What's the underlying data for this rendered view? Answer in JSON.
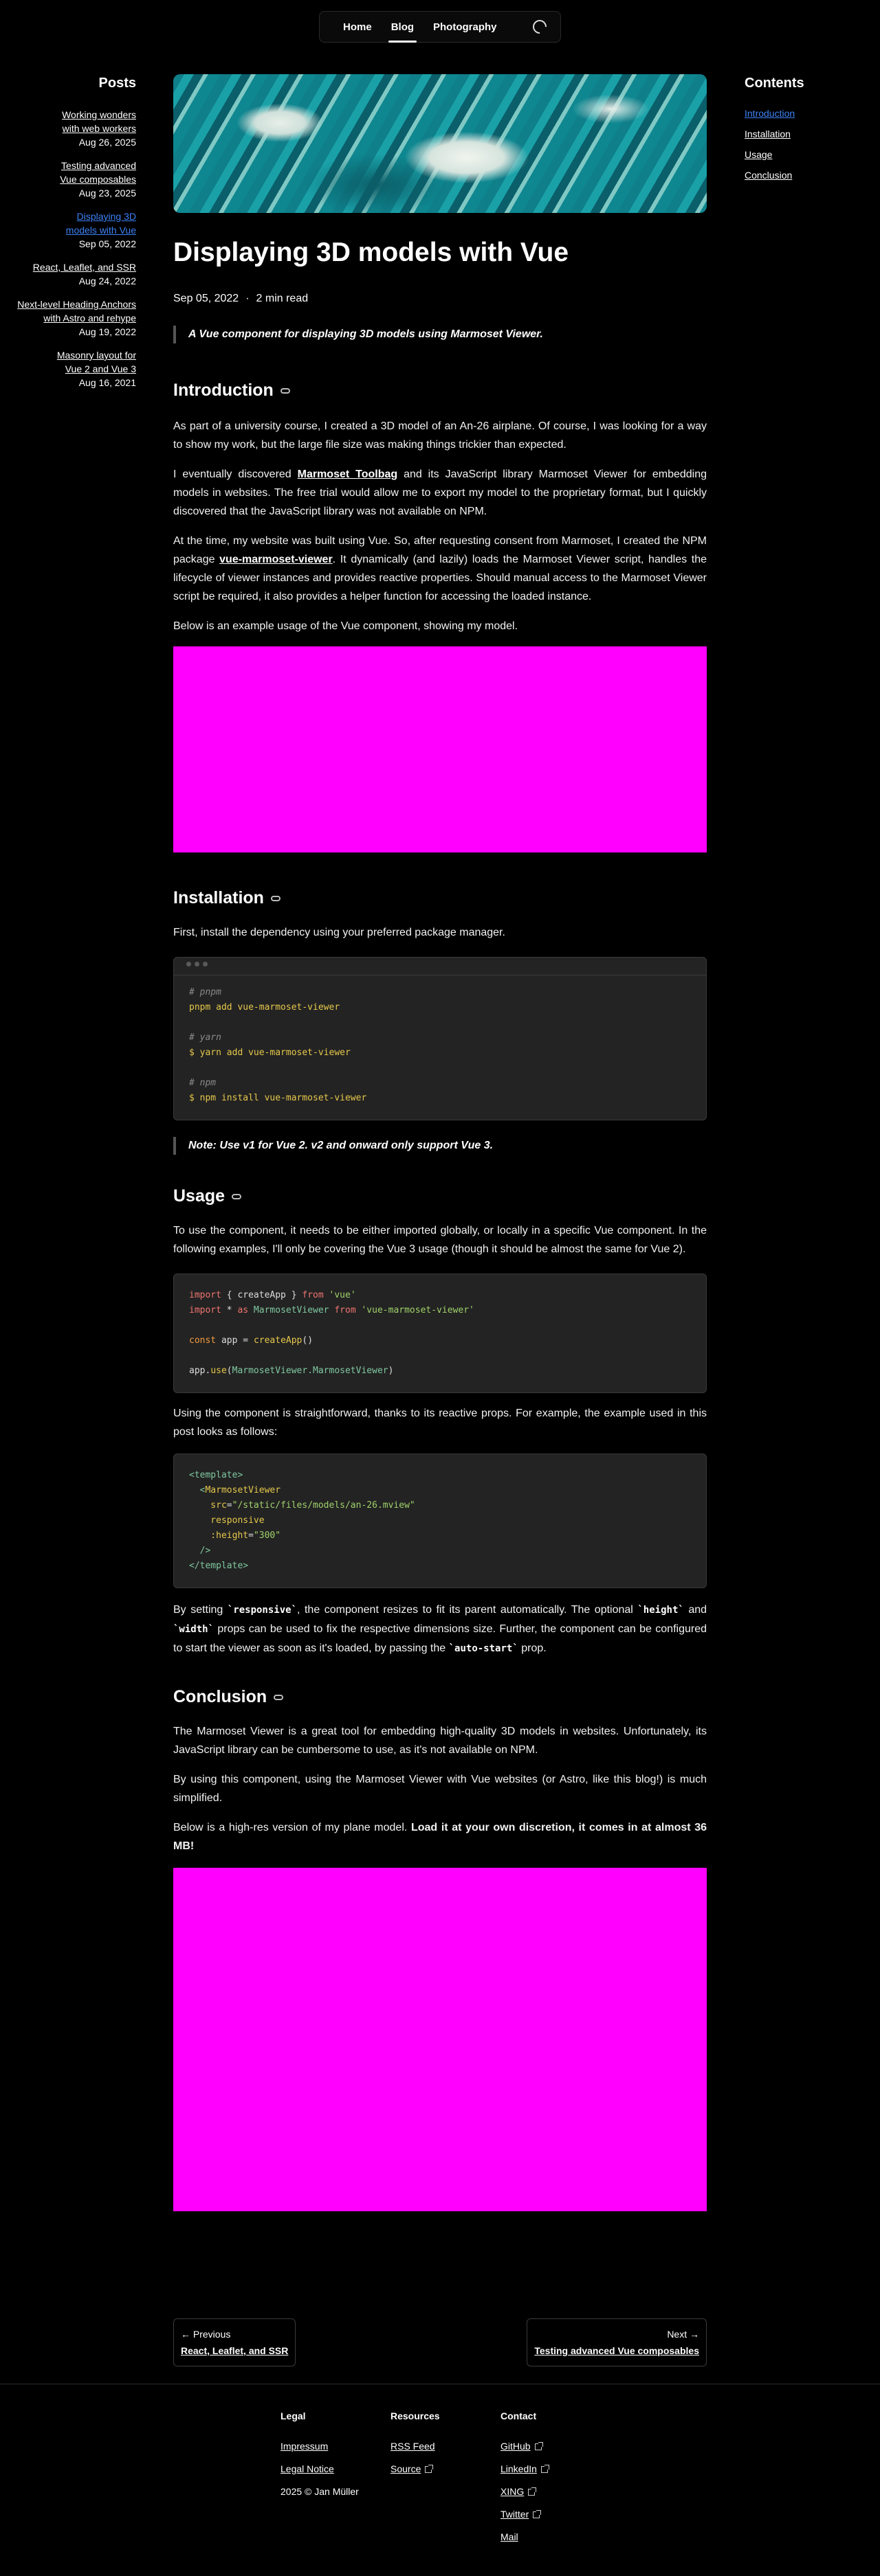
{
  "nav": {
    "items": [
      "Home",
      "Blog",
      "Photography"
    ],
    "active": "Blog"
  },
  "posts": {
    "title": "Posts",
    "items": [
      {
        "title": "Working wonders with web workers",
        "date": "Aug 26, 2025"
      },
      {
        "title": "Testing advanced Vue composables",
        "date": "Aug 23, 2025"
      },
      {
        "title": "Displaying 3D models with Vue",
        "date": "Sep 05, 2022"
      },
      {
        "title": "React, Leaflet, and SSR",
        "date": "Aug 24, 2022"
      },
      {
        "title": "Next-level Heading Anchors with Astro and rehype",
        "date": "Aug 19, 2022"
      },
      {
        "title": "Masonry layout for Vue 2 and Vue 3",
        "date": "Aug 16, 2021"
      }
    ]
  },
  "toc": {
    "title": "Contents",
    "items": [
      "Introduction",
      "Installation",
      "Usage",
      "Conclusion"
    ]
  },
  "article": {
    "title": "Displaying 3D models with Vue",
    "date": "Sep 05, 2022",
    "separator": "·",
    "read_time": "2 min read",
    "summary": "A Vue component for displaying 3D models using Marmoset Viewer.",
    "intro_heading": "Introduction",
    "intro_p1": "As part of a university course, I created a 3D model of an An-26 airplane. Of course, I was looking for a way to show my work, but the large file size was making things trickier than expected.",
    "intro_p2_a": "I eventually discovered ",
    "intro_p2_link": "Marmoset Toolbag",
    "intro_p2_b": " and its JavaScript library Marmoset Viewer for embedding models in websites. The free trial would allow me to export my model to the proprietary format, but I quickly discovered that the JavaScript library was not available on NPM.",
    "intro_p3_a": "At the time, my website was built using Vue. So, after requesting consent from Marmoset, I created the NPM package ",
    "intro_p3_link": "vue-marmoset-viewer",
    "intro_p3_b": ". It dynamically (and lazily) loads the Marmoset Viewer script, handles the lifecycle of viewer instances and provides reactive properties. Should manual access to the Marmoset Viewer script be required, it also provides a helper function for accessing the loaded instance.",
    "intro_p4": "Below is an example usage of the Vue component, showing my model.",
    "install_heading": "Installation",
    "install_p1": "First, install the dependency using your preferred package manager.",
    "install_code": [
      {
        "cls": "c",
        "text": "# pnpm"
      },
      {
        "cls": "y",
        "text": "pnpm add vue-marmoset-viewer"
      },
      {
        "cls": "w",
        "text": ""
      },
      {
        "cls": "c",
        "text": "# yarn"
      },
      {
        "cls": "y",
        "text": "$ yarn add vue-marmoset-viewer"
      },
      {
        "cls": "w",
        "text": ""
      },
      {
        "cls": "c",
        "text": "# npm"
      },
      {
        "cls": "y",
        "text": "$ npm install vue-marmoset-viewer"
      }
    ],
    "install_note": "Note: Use v1 for Vue 2. v2 and onward only support Vue 3.",
    "usage_heading": "Usage",
    "usage_p1": "To use the component, it needs to be either imported globally, or locally in a specific Vue component. In the following examples, I'll only be covering the Vue 3 usage (though it should be almost the same for Vue 2).",
    "usage_code1": [
      [
        {
          "cls": "r",
          "text": "import"
        },
        {
          "cls": "w",
          "text": " { createApp } "
        },
        {
          "cls": "r",
          "text": "from"
        },
        {
          "cls": "g",
          "text": " 'vue'"
        }
      ],
      [
        {
          "cls": "r",
          "text": "import"
        },
        {
          "cls": "w",
          "text": " * "
        },
        {
          "cls": "r",
          "text": "as"
        },
        {
          "cls": "t",
          "text": " MarmosetViewer "
        },
        {
          "cls": "r",
          "text": "from"
        },
        {
          "cls": "g",
          "text": " 'vue-marmoset-viewer'"
        }
      ],
      [
        {
          "cls": "w",
          "text": ""
        }
      ],
      [
        {
          "cls": "o",
          "text": "const"
        },
        {
          "cls": "w",
          "text": " app = "
        },
        {
          "cls": "y",
          "text": "createApp"
        },
        {
          "cls": "w",
          "text": "()"
        }
      ],
      [
        {
          "cls": "w",
          "text": ""
        }
      ],
      [
        {
          "cls": "w",
          "text": "app."
        },
        {
          "cls": "y",
          "text": "use"
        },
        {
          "cls": "w",
          "text": "("
        },
        {
          "cls": "t",
          "text": "MarmosetViewer.MarmosetViewer"
        },
        {
          "cls": "w",
          "text": ")"
        }
      ]
    ],
    "usage_p2": "Using the component is straightforward, thanks to its reactive props. For example, the example used in this post looks as follows:",
    "usage_code2": [
      [
        {
          "cls": "t",
          "text": "<template>"
        }
      ],
      [
        {
          "cls": "t",
          "text": "  <"
        },
        {
          "cls": "y",
          "text": "MarmosetViewer"
        }
      ],
      [
        {
          "cls": "y",
          "text": "    src"
        },
        {
          "cls": "w",
          "text": "="
        },
        {
          "cls": "g",
          "text": "\"/static/files/models/an-26.mview\""
        }
      ],
      [
        {
          "cls": "y",
          "text": "    responsive"
        }
      ],
      [
        {
          "cls": "y",
          "text": "    :height"
        },
        {
          "cls": "w",
          "text": "="
        },
        {
          "cls": "g",
          "text": "\"300\""
        }
      ],
      [
        {
          "cls": "t",
          "text": "  />"
        }
      ],
      [
        {
          "cls": "t",
          "text": "</template>"
        }
      ]
    ],
    "usage_p3_a": "By setting ",
    "usage_p3_code1": "`responsive`",
    "usage_p3_b": ", the component resizes to fit its parent automatically. The optional ",
    "usage_p3_code2": "`height`",
    "usage_p3_c": " and ",
    "usage_p3_code3": "`width`",
    "usage_p3_d": " props can be used to fix the respective dimensions size. Further, the component can be configured to start the viewer as soon as it's loaded, by passing the ",
    "usage_p3_code4": "`auto-start`",
    "usage_p3_e": " prop.",
    "conclusion_heading": "Conclusion",
    "conclusion_p1": "The Marmoset Viewer is a great tool for embedding high-quality 3D models in websites. Unfortunately, its JavaScript library can be cumbersome to use, as it's not available on NPM.",
    "conclusion_p2": "By using this component, using the Marmoset Viewer with Vue websites (or Astro, like this blog!) is much simplified.",
    "conclusion_p3_a": "Below is a high-res version of my plane model. ",
    "conclusion_p3_b": "Load it at your own discretion, it comes in at almost 36 MB!"
  },
  "pager": {
    "prev_label": "Previous",
    "prev_title": "React, Leaflet, and SSR",
    "next_label": "Next",
    "next_title": "Testing advanced Vue composables"
  },
  "footer": {
    "legal": {
      "heading": "Legal",
      "links": [
        "Impressum",
        "Legal Notice"
      ],
      "copyright": "2025 © Jan Müller"
    },
    "resources": {
      "heading": "Resources",
      "links": [
        "RSS Feed",
        "Source"
      ]
    },
    "contact": {
      "heading": "Contact",
      "links": [
        "GitHub",
        "LinkedIn",
        "XING",
        "Twitter",
        "Mail"
      ]
    }
  },
  "colors": {
    "accent": "#3b82f6",
    "viewer_placeholder": "#ff00ff",
    "background": "#000000"
  }
}
